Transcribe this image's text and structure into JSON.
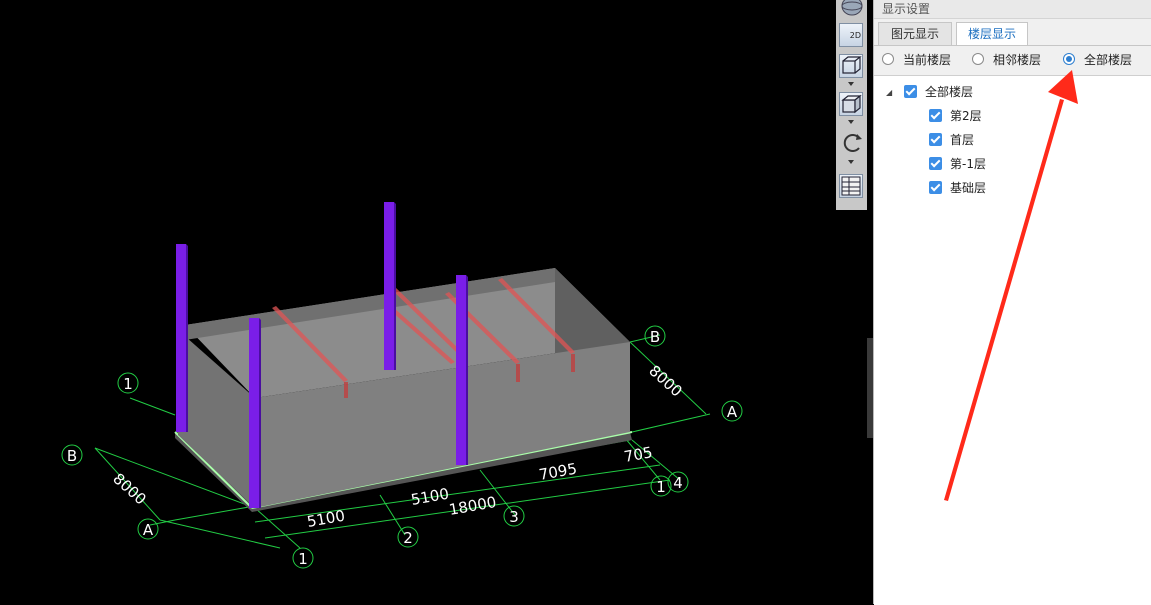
{
  "viewport": {
    "dim_labels": {
      "bottom_5100_a": "5100",
      "bottom_5100_b": "5100",
      "bottom_18000": "18000",
      "right_7095": "7095",
      "right_705": "705",
      "left_8000": "8000",
      "right_8000": "8000"
    },
    "axis_labels": {
      "bottom_1": "1",
      "bottom_2": "2",
      "bottom_3": "3",
      "right_1": "1",
      "right_4": "4",
      "left_A": "A",
      "left_B": "B",
      "left_1": "1",
      "right_A": "A",
      "right_B": "B"
    }
  },
  "toolbar": {
    "btn_2d": "2D"
  },
  "panel": {
    "title": "显示设置",
    "tabs": [
      {
        "label": "图元显示",
        "active": false
      },
      {
        "label": "楼层显示",
        "active": true
      }
    ],
    "radios": [
      {
        "label": "当前楼层",
        "checked": false
      },
      {
        "label": "相邻楼层",
        "checked": false
      },
      {
        "label": "全部楼层",
        "checked": true
      }
    ],
    "tree": {
      "root": {
        "label": "全部楼层",
        "checked": true
      },
      "children": [
        {
          "label": "第2层",
          "checked": true
        },
        {
          "label": "首层",
          "checked": true
        },
        {
          "label": "第-1层",
          "checked": true
        },
        {
          "label": "基础层",
          "checked": true
        }
      ]
    }
  },
  "colors": {
    "accent": "#2e7fd0",
    "checkbox": "#3c8ee6",
    "wall": "#808080",
    "column": "#7a1ee8",
    "beam": "#e05555",
    "grid": "#22cc44",
    "annotation_arrow": "#ff2a1a"
  }
}
